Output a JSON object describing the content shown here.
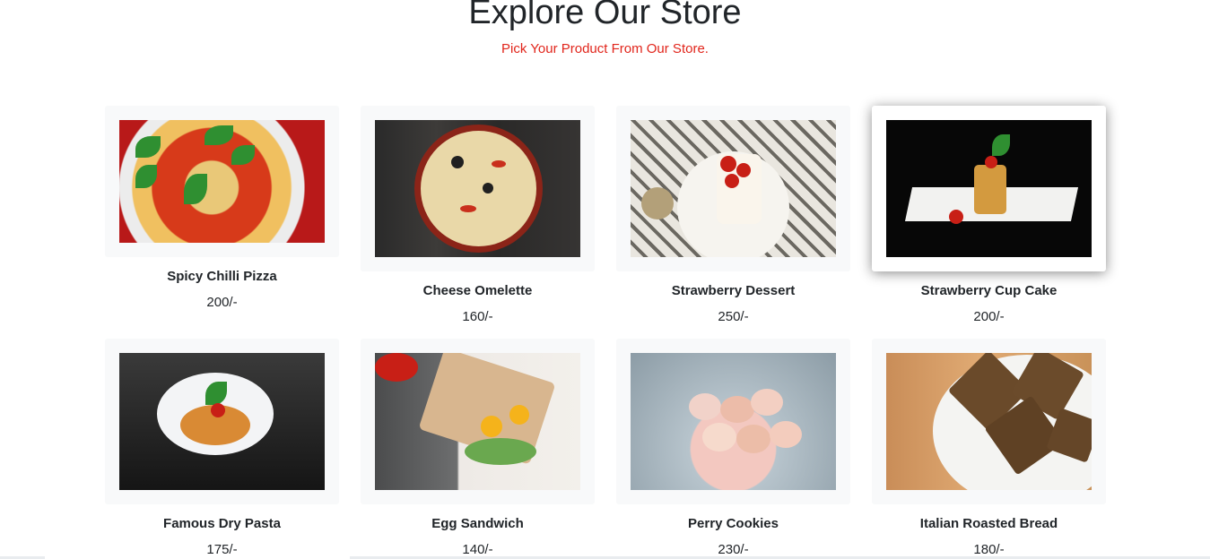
{
  "header": {
    "title": "Explore Our Store",
    "subtitle": "Pick Your Product From Our Store."
  },
  "products": [
    {
      "name": "Spicy Chilli Pizza",
      "price": "200/-",
      "image": "pizza-image"
    },
    {
      "name": "Cheese Omelette",
      "price": "160/-",
      "image": "pizza-image"
    },
    {
      "name": "Strawberry Dessert",
      "price": "250/-",
      "image": "dessert-image"
    },
    {
      "name": "Strawberry Cup Cake",
      "price": "200/-",
      "image": "cupcake-image"
    },
    {
      "name": "Famous Dry Pasta",
      "price": "175/-",
      "image": "pasta-image"
    },
    {
      "name": "Egg Sandwich",
      "price": "140/-",
      "image": "sandwich-image"
    },
    {
      "name": "Perry Cookies",
      "price": "230/-",
      "image": "cookies-image"
    },
    {
      "name": "Italian Roasted Bread",
      "price": "180/-",
      "image": "bread-image"
    }
  ],
  "colors": {
    "accent": "#e1251b",
    "card_bg": "#f8f9fa",
    "text": "#212529"
  }
}
